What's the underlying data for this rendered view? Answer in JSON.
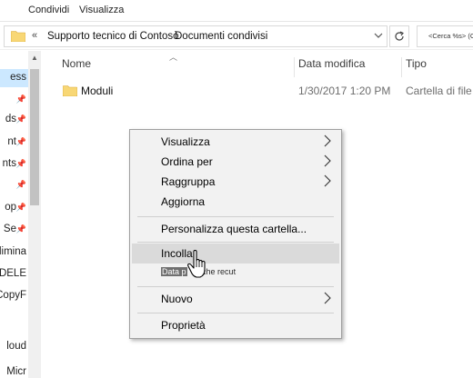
{
  "ribbon": {
    "tabs": [
      "Condividi",
      "Visualizza"
    ]
  },
  "address": {
    "back_chevron": "«",
    "crumbs": [
      "Supporto tecnico di Contosò",
      "Documenti condivisi"
    ],
    "search_placeholder": "<Cerca %s> (Ct"
  },
  "nav": {
    "items": [
      {
        "label": "ess",
        "pinned": false,
        "selected": true
      },
      {
        "label": "",
        "pinned": true
      },
      {
        "label": "ds",
        "pinned": true
      },
      {
        "label": "nt",
        "pinned": true
      },
      {
        "label": "nts",
        "pinned": true
      },
      {
        "label": "",
        "pinned": true
      },
      {
        "label": "op",
        "pinned": true
      },
      {
        "label": "Se",
        "pinned": true
      },
      {
        "label": "f elimina",
        "pinned": false
      },
      {
        "label": "DELE",
        "pinned": false
      },
      {
        "label": "CopyF",
        "pinned": false
      },
      {
        "label": "",
        "pinned": false
      },
      {
        "label": "loud",
        "pinned": false
      },
      {
        "label": "",
        "pinned": false
      },
      {
        "label": "Micr",
        "pinned": false
      }
    ]
  },
  "list": {
    "columns": [
      "Nome",
      "Data modifica",
      "Tipo"
    ],
    "rows": [
      {
        "name": "Moduli",
        "date": "1/30/2017 1:20 PM",
        "type": "Cartella di file"
      }
    ]
  },
  "context_menu": {
    "items": [
      {
        "label": "Visualizza",
        "submenu": true
      },
      {
        "label": "Ordina per",
        "submenu": true
      },
      {
        "label": "Raggruppa",
        "submenu": true
      },
      {
        "label": "Aggiorna",
        "submenu": false
      },
      {
        "label": "Personalizza questa cartella...",
        "submenu": false
      },
      {
        "label": "Incolla",
        "submenu": false,
        "highlighted": true
      },
      {
        "label": "Nuovo",
        "submenu": true
      },
      {
        "label": "Proprietà",
        "submenu": false
      }
    ],
    "tooltip_highlight": "Data p",
    "tooltip_rest": "che recut"
  },
  "colors": {
    "folder": "#f8d775",
    "hover": "#dadada",
    "selected_nav": "#cce8ff"
  },
  "icons": [
    "folder-icon",
    "chevron-down-icon",
    "refresh-icon",
    "pin-icon",
    "submenu-arrow-icon",
    "hand-cursor-icon"
  ]
}
